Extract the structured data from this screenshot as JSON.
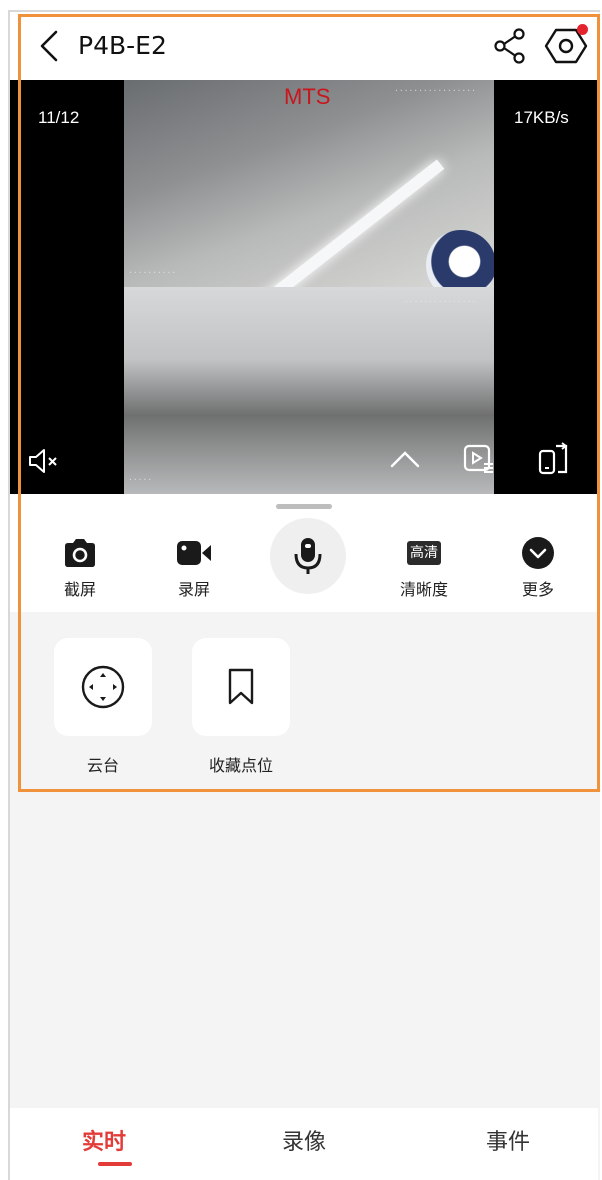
{
  "header": {
    "title": "P4B-E2"
  },
  "video": {
    "overlay_label": "MTS",
    "page_indicator": "11/12",
    "bitrate": "17KB/s"
  },
  "toolbar": {
    "screenshot_label": "截屏",
    "record_label": "录屏",
    "quality_badge": "高清",
    "quality_label": "清晰度",
    "more_label": "更多"
  },
  "functions": {
    "ptz_label": "云台",
    "favorite_label": "收藏点位"
  },
  "tabs": [
    {
      "label": "实时",
      "active": true
    },
    {
      "label": "录像",
      "active": false
    },
    {
      "label": "事件",
      "active": false
    }
  ],
  "colors": {
    "accent": "#e33b37",
    "highlight_border": "#f0923b",
    "notification_dot": "#e5232d"
  },
  "icons": [
    "back-icon",
    "share-icon",
    "settings-icon",
    "mute-icon",
    "chevron-up-icon",
    "playback-list-icon",
    "rotate-screen-icon",
    "camera-icon",
    "video-camera-icon",
    "microphone-icon",
    "chevron-down-circle-icon",
    "ptz-direction-icon",
    "bookmark-icon"
  ]
}
